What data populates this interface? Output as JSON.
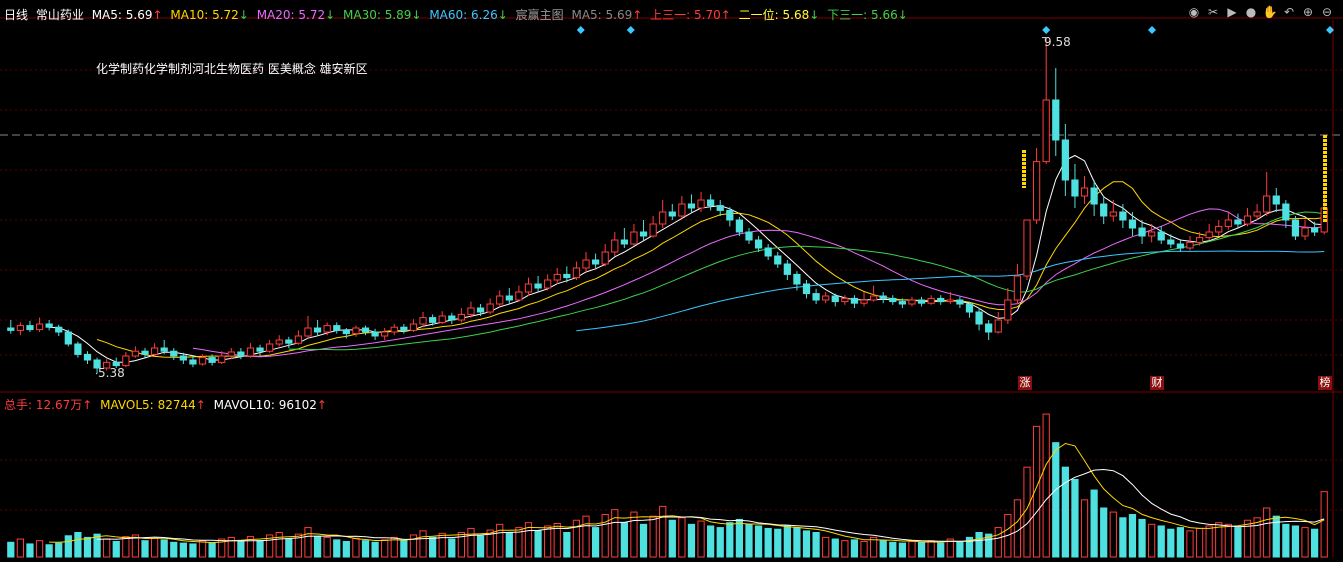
{
  "header": {
    "period": "日线",
    "stock_name": "常山药业",
    "ma5": {
      "label": "MA5:",
      "value": "5.69",
      "arrow": "↑",
      "color": "#ffffff"
    },
    "ma10": {
      "label": "MA10:",
      "value": "5.72",
      "arrow": "↓",
      "color": "#ffd700"
    },
    "ma20": {
      "label": "MA20:",
      "value": "5.72",
      "arrow": "↓",
      "color": "#e96bff"
    },
    "ma30": {
      "label": "MA30:",
      "value": "5.89",
      "arrow": "↓",
      "color": "#3cd24b"
    },
    "ma60": {
      "label": "MA60:",
      "value": "6.26",
      "arrow": "↓",
      "color": "#3cc7ff"
    },
    "indicator_name": "宸赢主图",
    "ind_ma5": {
      "label": "MA5:",
      "value": "5.69",
      "arrow": "↑",
      "color": "#888888"
    },
    "upper": {
      "label": "上三一:",
      "value": "5.70",
      "arrow": "↑",
      "color": "#ff3c3c"
    },
    "mid": {
      "label": "二一位:",
      "value": "5.68",
      "arrow": "↓",
      "color": "#ffff33"
    },
    "lower": {
      "label": "下三一:",
      "value": "5.66",
      "arrow": "↓",
      "color": "#3cd24b"
    }
  },
  "concepts_text": "化学制药化学制剂河北生物医药  医美概念  雄安新区",
  "price_annotations": {
    "high": "9.58",
    "low": "5.38"
  },
  "event_markers": [
    "涨",
    "财",
    "榜"
  ],
  "volume_header": {
    "total": {
      "label": "总手:",
      "value": "12.67万",
      "arrow": "↑",
      "color": "#ff3c3c"
    },
    "mavol5": {
      "label": "MAVOL5:",
      "value": "82744",
      "arrow": "↑",
      "color": "#ffd700"
    },
    "mavol10": {
      "label": "MAVOL10:",
      "value": "96102",
      "arrow": "↑",
      "color": "#ffffff"
    }
  },
  "toolbar_icons": [
    "eye-icon",
    "scissors-icon",
    "play-icon",
    "record-icon",
    "hand-icon",
    "undo-icon",
    "zoom-in-icon",
    "zoom-out-icon"
  ],
  "chart_data": {
    "type": "candlestick",
    "price_range": [
      5.2,
      9.8
    ],
    "candles": [
      [
        5.95,
        5.92,
        6.05,
        5.88
      ],
      [
        5.92,
        5.98,
        6.02,
        5.86
      ],
      [
        5.98,
        5.93,
        6.04,
        5.9
      ],
      [
        5.93,
        6.0,
        6.08,
        5.9
      ],
      [
        6.0,
        5.96,
        6.05,
        5.92
      ],
      [
        5.96,
        5.9,
        5.99,
        5.85
      ],
      [
        5.9,
        5.75,
        5.93,
        5.72
      ],
      [
        5.75,
        5.62,
        5.78,
        5.58
      ],
      [
        5.62,
        5.55,
        5.66,
        5.5
      ],
      [
        5.55,
        5.45,
        5.58,
        5.38
      ],
      [
        5.45,
        5.52,
        5.56,
        5.42
      ],
      [
        5.52,
        5.48,
        5.58,
        5.45
      ],
      [
        5.48,
        5.6,
        5.65,
        5.46
      ],
      [
        5.6,
        5.66,
        5.72,
        5.58
      ],
      [
        5.66,
        5.62,
        5.7,
        5.58
      ],
      [
        5.62,
        5.7,
        5.76,
        5.6
      ],
      [
        5.7,
        5.66,
        5.8,
        5.62
      ],
      [
        5.66,
        5.6,
        5.7,
        5.55
      ],
      [
        5.6,
        5.55,
        5.64,
        5.5
      ],
      [
        5.55,
        5.5,
        5.6,
        5.46
      ],
      [
        5.5,
        5.58,
        5.62,
        5.48
      ],
      [
        5.58,
        5.52,
        5.62,
        5.48
      ],
      [
        5.52,
        5.6,
        5.66,
        5.5
      ],
      [
        5.6,
        5.65,
        5.7,
        5.56
      ],
      [
        5.65,
        5.6,
        5.7,
        5.56
      ],
      [
        5.6,
        5.7,
        5.76,
        5.58
      ],
      [
        5.7,
        5.66,
        5.74,
        5.6
      ],
      [
        5.66,
        5.75,
        5.8,
        5.64
      ],
      [
        5.75,
        5.8,
        5.86,
        5.72
      ],
      [
        5.8,
        5.76,
        5.84,
        5.7
      ],
      [
        5.76,
        5.85,
        5.92,
        5.74
      ],
      [
        5.85,
        5.95,
        6.1,
        5.82
      ],
      [
        5.95,
        5.9,
        6.05,
        5.85
      ],
      [
        5.9,
        5.98,
        6.02,
        5.86
      ],
      [
        5.98,
        5.92,
        6.02,
        5.88
      ],
      [
        5.92,
        5.88,
        5.95,
        5.82
      ],
      [
        5.88,
        5.95,
        5.98,
        5.84
      ],
      [
        5.95,
        5.9,
        5.98,
        5.86
      ],
      [
        5.9,
        5.85,
        5.94,
        5.8
      ],
      [
        5.85,
        5.9,
        5.95,
        5.8
      ],
      [
        5.9,
        5.96,
        6.0,
        5.86
      ],
      [
        5.96,
        5.92,
        6.0,
        5.88
      ],
      [
        5.92,
        6.0,
        6.06,
        5.9
      ],
      [
        6.0,
        6.08,
        6.15,
        5.96
      ],
      [
        6.08,
        6.02,
        6.12,
        5.98
      ],
      [
        6.02,
        6.1,
        6.16,
        6.0
      ],
      [
        6.1,
        6.05,
        6.14,
        6.0
      ],
      [
        6.05,
        6.12,
        6.2,
        6.02
      ],
      [
        6.12,
        6.2,
        6.28,
        6.08
      ],
      [
        6.2,
        6.15,
        6.25,
        6.1
      ],
      [
        6.15,
        6.25,
        6.32,
        6.12
      ],
      [
        6.25,
        6.35,
        6.42,
        6.2
      ],
      [
        6.35,
        6.3,
        6.45,
        6.25
      ],
      [
        6.3,
        6.4,
        6.48,
        6.28
      ],
      [
        6.4,
        6.5,
        6.58,
        6.35
      ],
      [
        6.5,
        6.45,
        6.6,
        6.4
      ],
      [
        6.45,
        6.55,
        6.62,
        6.42
      ],
      [
        6.55,
        6.62,
        6.7,
        6.5
      ],
      [
        6.62,
        6.58,
        6.72,
        6.52
      ],
      [
        6.58,
        6.7,
        6.78,
        6.55
      ],
      [
        6.7,
        6.8,
        6.9,
        6.65
      ],
      [
        6.8,
        6.75,
        6.88,
        6.7
      ],
      [
        6.75,
        6.9,
        7.0,
        6.72
      ],
      [
        6.9,
        7.05,
        7.15,
        6.85
      ],
      [
        7.05,
        7.0,
        7.2,
        6.95
      ],
      [
        7.0,
        7.15,
        7.25,
        6.98
      ],
      [
        7.15,
        7.1,
        7.3,
        7.05
      ],
      [
        7.1,
        7.25,
        7.35,
        7.08
      ],
      [
        7.25,
        7.4,
        7.55,
        7.2
      ],
      [
        7.4,
        7.35,
        7.5,
        7.3
      ],
      [
        7.35,
        7.5,
        7.6,
        7.32
      ],
      [
        7.5,
        7.45,
        7.62,
        7.4
      ],
      [
        7.45,
        7.55,
        7.65,
        7.4
      ],
      [
        7.55,
        7.48,
        7.62,
        7.42
      ],
      [
        7.48,
        7.42,
        7.55,
        7.35
      ],
      [
        7.42,
        7.3,
        7.46,
        7.22
      ],
      [
        7.3,
        7.15,
        7.34,
        7.1
      ],
      [
        7.15,
        7.05,
        7.2,
        7.0
      ],
      [
        7.05,
        6.95,
        7.1,
        6.9
      ],
      [
        6.95,
        6.85,
        7.0,
        6.8
      ],
      [
        6.85,
        6.75,
        6.9,
        6.7
      ],
      [
        6.75,
        6.62,
        6.8,
        6.55
      ],
      [
        6.62,
        6.5,
        6.66,
        6.42
      ],
      [
        6.5,
        6.38,
        6.55,
        6.32
      ],
      [
        6.38,
        6.3,
        6.44,
        6.25
      ],
      [
        6.3,
        6.35,
        6.4,
        6.26
      ],
      [
        6.35,
        6.28,
        6.38,
        6.22
      ],
      [
        6.28,
        6.32,
        6.36,
        6.24
      ],
      [
        6.32,
        6.26,
        6.36,
        6.2
      ],
      [
        6.26,
        6.3,
        6.4,
        6.22
      ],
      [
        6.3,
        6.35,
        6.48,
        6.28
      ],
      [
        6.35,
        6.32,
        6.4,
        6.26
      ],
      [
        6.32,
        6.28,
        6.36,
        6.24
      ],
      [
        6.28,
        6.25,
        6.32,
        6.2
      ],
      [
        6.25,
        6.3,
        6.34,
        6.22
      ],
      [
        6.3,
        6.26,
        6.34,
        6.22
      ],
      [
        6.26,
        6.32,
        6.36,
        6.24
      ],
      [
        6.32,
        6.28,
        6.36,
        6.24
      ],
      [
        6.28,
        6.3,
        6.4,
        6.25
      ],
      [
        6.3,
        6.25,
        6.34,
        6.2
      ],
      [
        6.25,
        6.15,
        6.28,
        6.08
      ],
      [
        6.15,
        6.0,
        6.2,
        5.92
      ],
      [
        6.0,
        5.9,
        6.05,
        5.8
      ],
      [
        5.9,
        6.05,
        6.15,
        5.88
      ],
      [
        6.05,
        6.3,
        6.45,
        6.0
      ],
      [
        6.3,
        6.6,
        6.75,
        6.25
      ],
      [
        6.6,
        7.3,
        7.3,
        6.55
      ],
      [
        7.3,
        8.03,
        8.2,
        7.25
      ],
      [
        8.03,
        8.8,
        9.58,
        8.0
      ],
      [
        8.8,
        8.3,
        9.2,
        8.1
      ],
      [
        8.3,
        7.8,
        8.5,
        7.6
      ],
      [
        7.8,
        7.6,
        8.0,
        7.45
      ],
      [
        7.6,
        7.7,
        7.85,
        7.5
      ],
      [
        7.7,
        7.5,
        7.8,
        7.35
      ],
      [
        7.5,
        7.35,
        7.6,
        7.25
      ],
      [
        7.35,
        7.4,
        7.55,
        7.28
      ],
      [
        7.4,
        7.3,
        7.5,
        7.2
      ],
      [
        7.3,
        7.2,
        7.4,
        7.1
      ],
      [
        7.2,
        7.1,
        7.3,
        7.0
      ],
      [
        7.1,
        7.15,
        7.25,
        7.02
      ],
      [
        7.15,
        7.05,
        7.22,
        7.0
      ],
      [
        7.05,
        7.0,
        7.12,
        6.95
      ],
      [
        7.0,
        6.95,
        7.06,
        6.9
      ],
      [
        6.95,
        7.02,
        7.1,
        6.92
      ],
      [
        7.02,
        7.08,
        7.15,
        6.98
      ],
      [
        7.08,
        7.15,
        7.25,
        7.05
      ],
      [
        7.15,
        7.22,
        7.3,
        7.1
      ],
      [
        7.22,
        7.3,
        7.4,
        7.18
      ],
      [
        7.3,
        7.25,
        7.38,
        7.2
      ],
      [
        7.25,
        7.35,
        7.45,
        7.22
      ],
      [
        7.35,
        7.4,
        7.5,
        7.3
      ],
      [
        7.4,
        7.6,
        7.9,
        7.35
      ],
      [
        7.6,
        7.5,
        7.7,
        7.4
      ],
      [
        7.5,
        7.3,
        7.55,
        7.2
      ],
      [
        7.3,
        7.1,
        7.35,
        7.05
      ],
      [
        7.1,
        7.2,
        7.3,
        7.05
      ],
      [
        7.2,
        7.15,
        7.28,
        7.1
      ],
      [
        7.15,
        7.45,
        7.65,
        7.12
      ]
    ],
    "volume_range": [
      0,
      180000
    ],
    "volumes": [
      18000,
      22000,
      16000,
      20000,
      15000,
      17000,
      26000,
      30000,
      24000,
      28000,
      22000,
      19000,
      25000,
      27000,
      20000,
      23000,
      21000,
      18000,
      17000,
      16000,
      20000,
      17000,
      22000,
      24000,
      19000,
      25000,
      20000,
      27000,
      30000,
      22000,
      28000,
      36000,
      25000,
      24000,
      21000,
      19000,
      23000,
      20000,
      18000,
      21000,
      24000,
      20000,
      27000,
      32000,
      24000,
      29000,
      22000,
      30000,
      35000,
      26000,
      33000,
      40000,
      30000,
      36000,
      42000,
      32000,
      38000,
      41000,
      30000,
      45000,
      50000,
      36000,
      52000,
      58000,
      42000,
      55000,
      40000,
      50000,
      62000,
      45000,
      48000,
      40000,
      44000,
      38000,
      36000,
      42000,
      46000,
      40000,
      38000,
      35000,
      34000,
      38000,
      36000,
      32000,
      30000,
      24000,
      22000,
      20000,
      21000,
      19000,
      24000,
      20000,
      18000,
      17000,
      19000,
      18000,
      20000,
      17000,
      22000,
      18000,
      24000,
      30000,
      28000,
      36000,
      52000,
      70000,
      110000,
      160000,
      175000,
      140000,
      110000,
      95000,
      70000,
      82000,
      60000,
      55000,
      48000,
      52000,
      46000,
      40000,
      38000,
      34000,
      36000,
      32000,
      35000,
      38000,
      42000,
      40000,
      36000,
      45000,
      48000,
      60000,
      50000,
      40000,
      38000,
      36000,
      34000,
      80000
    ]
  }
}
